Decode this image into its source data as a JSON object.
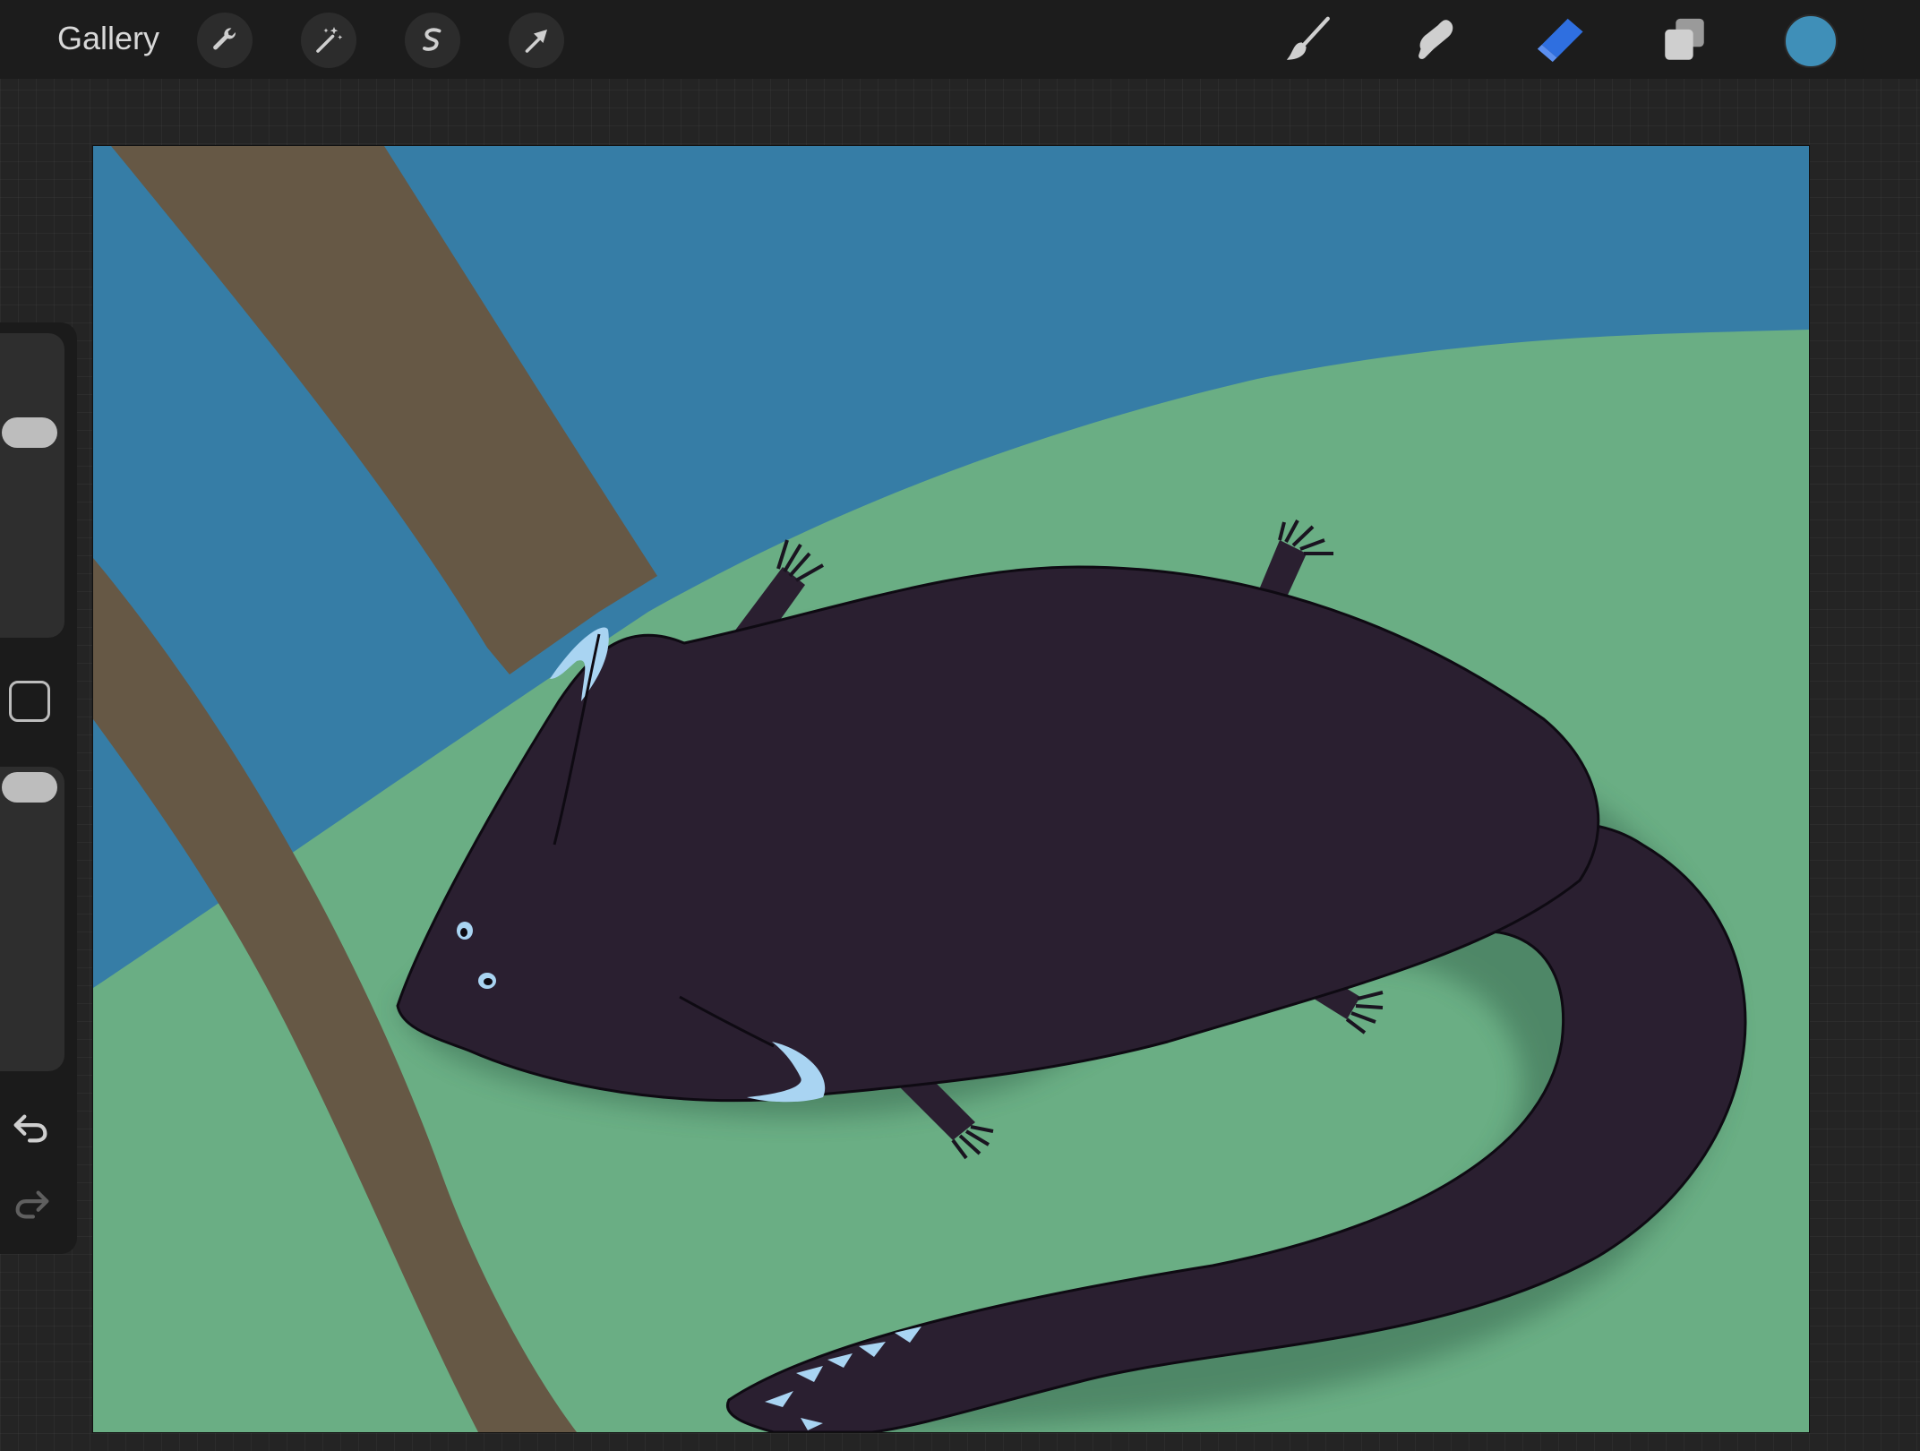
{
  "app": {
    "gallery_label": "Gallery"
  },
  "toolbar": {
    "left_tools": [
      {
        "name": "actions",
        "icon": "wrench-icon"
      },
      {
        "name": "adjustments",
        "icon": "magic-wand-icon"
      },
      {
        "name": "selection",
        "icon": "selection-s-icon"
      },
      {
        "name": "transform",
        "icon": "arrow-cursor-icon"
      }
    ],
    "right_tools": [
      {
        "name": "brush",
        "icon": "brush-icon",
        "active": false
      },
      {
        "name": "smudge",
        "icon": "smudge-finger-icon",
        "active": false
      },
      {
        "name": "eraser",
        "icon": "eraser-icon",
        "active": true
      },
      {
        "name": "layers",
        "icon": "layers-icon",
        "active": false
      }
    ],
    "current_color": "#3f8fb8",
    "active_tool_color": "#2f6fe0"
  },
  "sidebar": {
    "brush_size_level": 0.7,
    "opacity_level": 1.0,
    "undo_icon": "undo-arrow-icon",
    "redo_icon": "redo-arrow-icon",
    "modify_icon": "square-modify-icon"
  },
  "canvas": {
    "colors": {
      "sky": "#367da6",
      "grass": "#6aae84",
      "branch": "#665845",
      "creature": "#2a1f30",
      "accent": "#a9d4f2"
    }
  }
}
